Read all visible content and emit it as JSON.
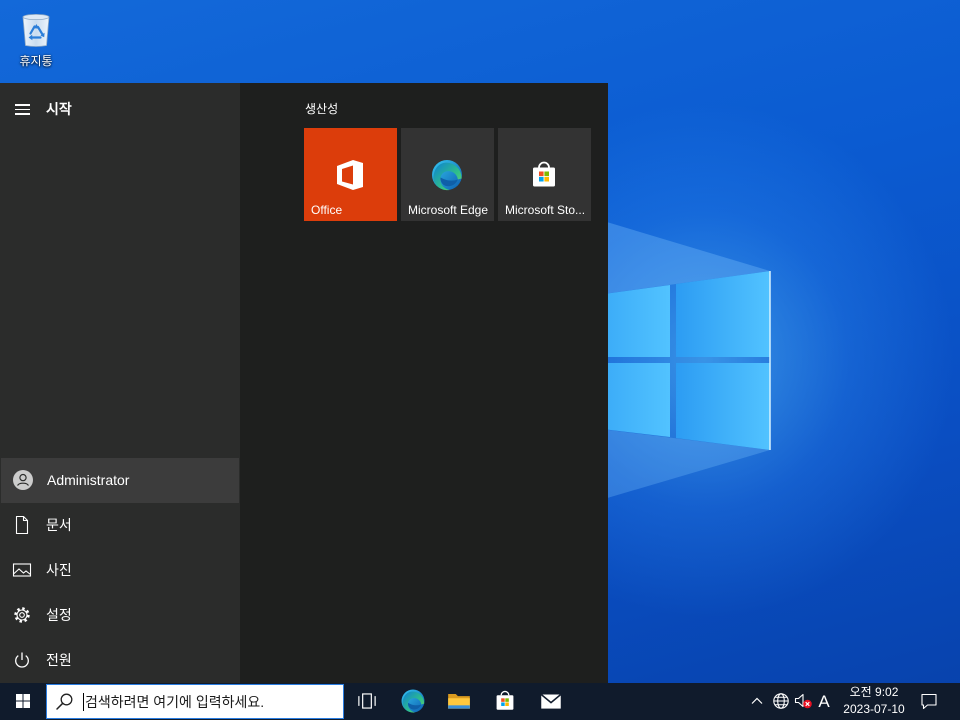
{
  "desktop": {
    "recycle_bin": {
      "label": "휴지통",
      "icon": "recycle-bin-icon"
    }
  },
  "start_menu": {
    "title": "시작",
    "menu_icon": "hamburger-menu-icon",
    "user": {
      "label": "Administrator",
      "icon": "user-avatar-icon",
      "highlighted": true
    },
    "places": [
      {
        "label": "문서",
        "icon": "document-icon"
      },
      {
        "label": "사진",
        "icon": "pictures-icon"
      },
      {
        "label": "설정",
        "icon": "gear-icon"
      },
      {
        "label": "전원",
        "icon": "power-icon"
      }
    ],
    "group": {
      "label": "생산성",
      "tiles": [
        {
          "label": "Office",
          "icon": "office-icon",
          "color": "#dc3d0b"
        },
        {
          "label": "Microsoft Edge",
          "icon": "edge-icon",
          "color": "#333333"
        },
        {
          "label": "Microsoft Sto...",
          "icon": "store-icon",
          "color": "#333333"
        }
      ]
    }
  },
  "taskbar": {
    "start_icon": "windows-logo-icon",
    "search": {
      "placeholder": "검색하려면 여기에 입력하세요.",
      "icon": "search-icon"
    },
    "pinned": [
      {
        "icon": "task-view-icon"
      },
      {
        "icon": "edge-icon"
      },
      {
        "icon": "file-explorer-icon"
      },
      {
        "icon": "store-icon"
      },
      {
        "icon": "mail-icon"
      }
    ],
    "tray": {
      "icons": [
        "chevron-up-icon",
        "network-globe-icon",
        "volume-muted-icon"
      ],
      "ime": "A",
      "time": "오전 9:02",
      "date": "2023-07-10",
      "notification_icon": "action-center-icon"
    }
  },
  "colors": {
    "start_left": "#2b2c2b",
    "start_right": "#1e1f1e",
    "highlight": "#3c3c3c",
    "taskbar": "#101b2c",
    "search_border": "#2a7de1"
  }
}
